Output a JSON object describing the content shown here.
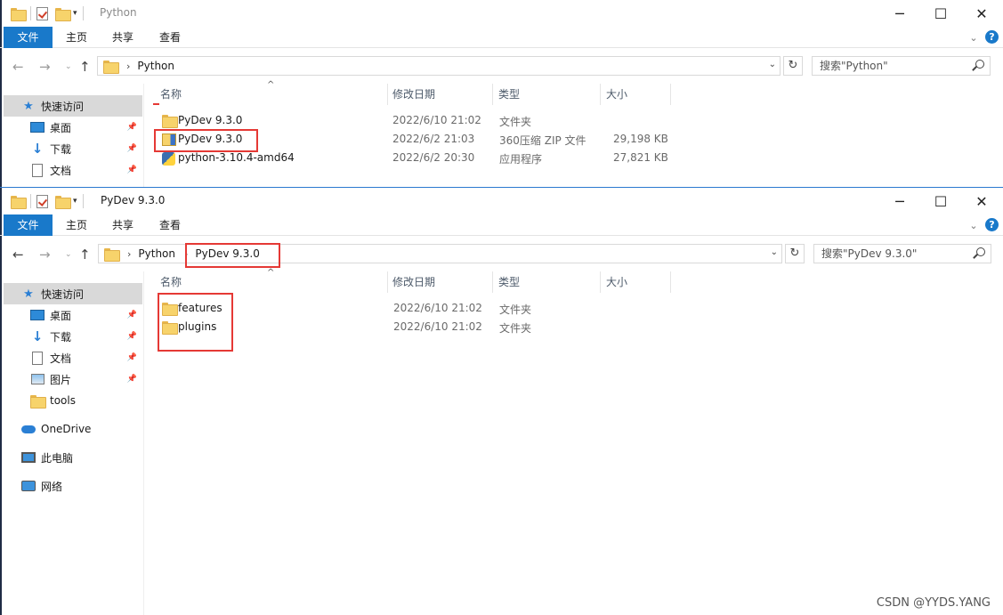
{
  "window1": {
    "title": "Python",
    "ribbon_tabs": [
      "文件",
      "主页",
      "共享",
      "查看"
    ],
    "address": {
      "crumbs": [
        "Python"
      ]
    },
    "search_placeholder": "搜索\"Python\"",
    "nav": [
      {
        "label": "快速访问",
        "icon": "star-icon"
      },
      {
        "label": "桌面",
        "icon": "desktop-icon",
        "pinned": true
      },
      {
        "label": "下载",
        "icon": "download-icon",
        "pinned": true
      },
      {
        "label": "文档",
        "icon": "document-icon",
        "pinned": true
      }
    ],
    "columns": [
      "名称",
      "修改日期",
      "类型",
      "大小"
    ],
    "files": [
      {
        "name": "PyDev 9.3.0",
        "date": "2022/6/10 21:02",
        "type": "文件夹",
        "size": "",
        "icon": "folder-icon"
      },
      {
        "name": "PyDev 9.3.0",
        "date": "2022/6/2 21:03",
        "type": "360压缩 ZIP 文件",
        "size": "29,198 KB",
        "icon": "zip-icon"
      },
      {
        "name": "python-3.10.4-amd64",
        "date": "2022/6/2 20:30",
        "type": "应用程序",
        "size": "27,821 KB",
        "icon": "installer-icon"
      }
    ]
  },
  "window2": {
    "title": "PyDev 9.3.0",
    "ribbon_tabs": [
      "文件",
      "主页",
      "共享",
      "查看"
    ],
    "address": {
      "crumbs": [
        "Python",
        "PyDev 9.3.0"
      ]
    },
    "search_placeholder": "搜索\"PyDev 9.3.0\"",
    "nav": [
      {
        "label": "快速访问",
        "icon": "star-icon"
      },
      {
        "label": "桌面",
        "icon": "desktop-icon",
        "pinned": true
      },
      {
        "label": "下载",
        "icon": "download-icon",
        "pinned": true
      },
      {
        "label": "文档",
        "icon": "document-icon",
        "pinned": true
      },
      {
        "label": "图片",
        "icon": "pictures-icon",
        "pinned": true
      },
      {
        "label": "tools",
        "icon": "folder-icon"
      },
      {
        "label": "OneDrive",
        "icon": "onedrive-icon"
      },
      {
        "label": "此电脑",
        "icon": "this-pc-icon"
      },
      {
        "label": "网络",
        "icon": "network-icon"
      }
    ],
    "columns": [
      "名称",
      "修改日期",
      "类型",
      "大小"
    ],
    "files": [
      {
        "name": "features",
        "date": "2022/6/10 21:02",
        "type": "文件夹",
        "size": "",
        "icon": "folder-icon"
      },
      {
        "name": "plugins",
        "date": "2022/6/10 21:02",
        "type": "文件夹",
        "size": "",
        "icon": "folder-icon"
      }
    ]
  },
  "watermark": "CSDN @YYDS.YANG",
  "colors": {
    "accent": "#1979ca",
    "highlight_box": "#e53935",
    "selected_nav": "#d9d9d9"
  }
}
